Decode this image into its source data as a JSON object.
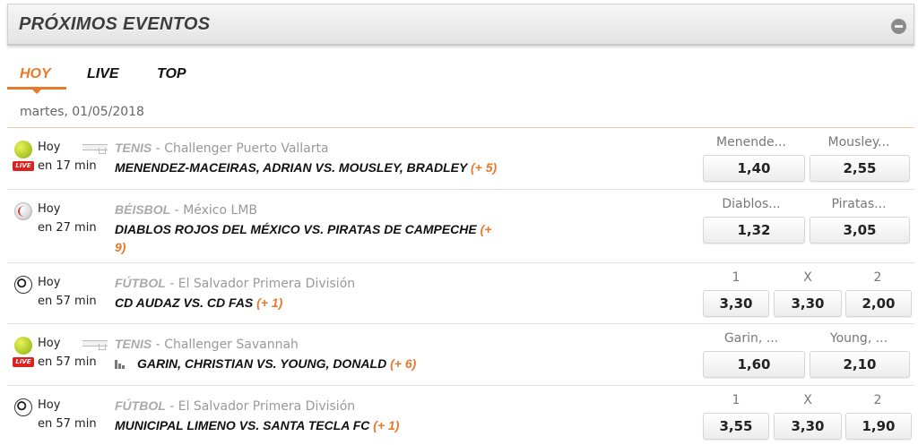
{
  "header": {
    "title": "PRÓXIMOS EVENTOS"
  },
  "tabs": [
    {
      "label": "HOY"
    },
    {
      "label": "LIVE"
    },
    {
      "label": "TOP"
    }
  ],
  "date": "martes, 01/05/2018",
  "colors": {
    "accent": "#e9782b",
    "live": "#dd2222"
  },
  "events": [
    {
      "icon": "tennis-ball-icon",
      "day": "Hoy",
      "time": "en 17 min",
      "live": "LIVE",
      "sport": "TENIS",
      "competition": "Challenger Puerto Vallarta",
      "match": "MENENDEZ-MACEIRAS, ADRIAN VS. MOUSLEY, BRADLEY",
      "more": "(+ 5)",
      "odds": [
        {
          "label": "Menende...",
          "value": "1,40"
        },
        {
          "label": "Mousley...",
          "value": "2,55"
        }
      ]
    },
    {
      "icon": "baseball-icon",
      "day": "Hoy",
      "time": "en 27 min",
      "sport": "BÉISBOL",
      "competition": "México LMB",
      "match": "DIABLOS ROJOS DEL MÉXICO VS. PIRATAS DE CAMPECHE",
      "more_line1": "(+",
      "more_line2": "9)",
      "odds": [
        {
          "label": "Diablos...",
          "value": "1,32"
        },
        {
          "label": "Piratas...",
          "value": "3,05"
        }
      ]
    },
    {
      "icon": "soccer-ball-icon",
      "day": "Hoy",
      "time": "en 57 min",
      "sport": "FÚTBOL",
      "competition": "El Salvador Primera División",
      "match": "CD AUDAZ VS. CD FAS",
      "more": "(+ 1)",
      "odds": [
        {
          "label": "1",
          "value": "3,30"
        },
        {
          "label": "X",
          "value": "3,30"
        },
        {
          "label": "2",
          "value": "2,00"
        }
      ]
    },
    {
      "icon": "tennis-ball-icon",
      "day": "Hoy",
      "time": "en 57 min",
      "live": "LIVE",
      "sport": "TENIS",
      "competition": "Challenger Savannah",
      "match": "GARIN, CHRISTIAN VS. YOUNG, DONALD",
      "more": "(+ 6)",
      "odds": [
        {
          "label": "Garin, ...",
          "value": "1,60"
        },
        {
          "label": "Young, ...",
          "value": "2,10"
        }
      ]
    },
    {
      "icon": "soccer-ball-icon",
      "day": "Hoy",
      "time": "en 57 min",
      "sport": "FÚTBOL",
      "competition": "El Salvador Primera División",
      "match": "MUNICIPAL LIMENO VS. SANTA TECLA FC",
      "more": "(+ 1)",
      "odds": [
        {
          "label": "1",
          "value": "3,55"
        },
        {
          "label": "X",
          "value": "3,30"
        },
        {
          "label": "2",
          "value": "1,90"
        }
      ]
    }
  ]
}
